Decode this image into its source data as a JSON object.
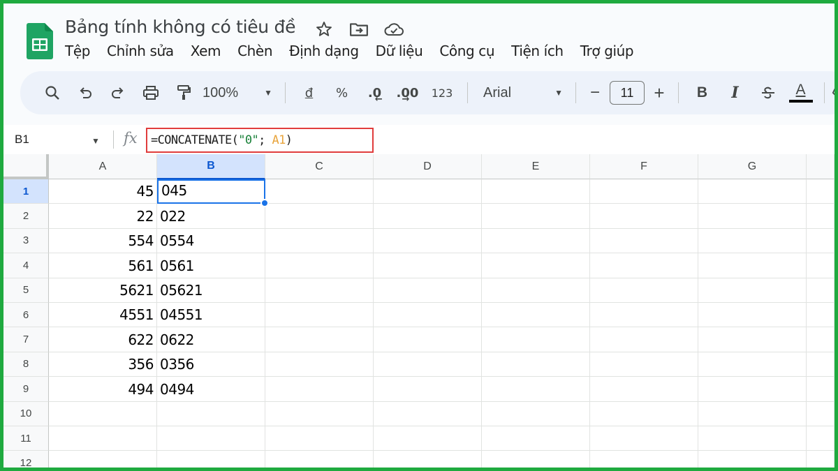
{
  "app": {
    "title": "Bảng tính không có tiêu đề",
    "accent": "#1faa3f",
    "menu": [
      "Tệp",
      "Chỉnh sửa",
      "Xem",
      "Chèn",
      "Định dạng",
      "Dữ liệu",
      "Công cụ",
      "Tiện ích",
      "Trợ giúp"
    ]
  },
  "toolbar": {
    "zoom": "100%",
    "currency": "đ",
    "percent": "%",
    "decrease_decimal": ".0",
    "increase_decimal": ".00",
    "number_format": "123",
    "font": "Arial",
    "font_size": "11",
    "minus": "−",
    "plus": "+",
    "bold": "B",
    "italic": "I",
    "text_color_letter": "A"
  },
  "formula_bar": {
    "name_box": "B1",
    "fx": "fx",
    "formula_parts": {
      "start": "=CONCATENATE(",
      "string": "\"0\"",
      "sep": "; ",
      "ref": "A1",
      "end": ")"
    }
  },
  "sheet": {
    "columns": [
      "A",
      "B",
      "C",
      "D",
      "E",
      "F",
      "G"
    ],
    "selected_column": "B",
    "rows": [
      "1",
      "2",
      "3",
      "4",
      "5",
      "6",
      "7",
      "8",
      "9",
      "10",
      "11",
      "12"
    ],
    "selected_row": "1",
    "col_a": [
      "45",
      "22",
      "554",
      "561",
      "5621",
      "4551",
      "622",
      "356",
      "494"
    ],
    "col_b": [
      "045",
      "022",
      "0554",
      "0561",
      "05621",
      "04551",
      "0622",
      "0356",
      "0494"
    ]
  }
}
